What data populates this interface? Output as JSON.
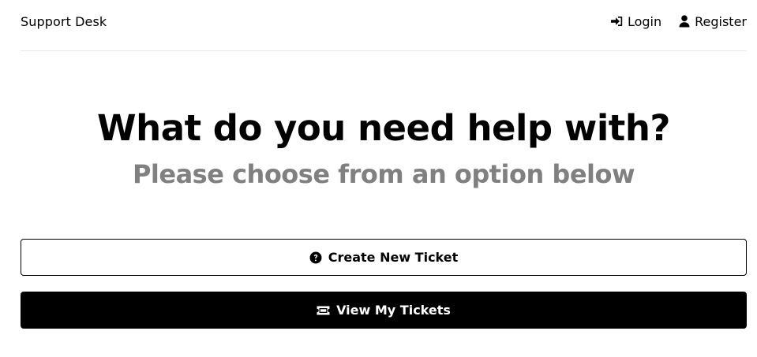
{
  "header": {
    "logo": "Support Desk",
    "nav": [
      {
        "label": "Login",
        "icon": "sign-in-icon"
      },
      {
        "label": "Register",
        "icon": "user-icon"
      }
    ]
  },
  "main": {
    "title": "What do you need help with?",
    "subtitle": "Please choose from an option below",
    "buttons": [
      {
        "label": "Create New Ticket",
        "icon": "question-circle-icon",
        "style": "outline"
      },
      {
        "label": "View My Tickets",
        "icon": "ticket-icon",
        "style": "solid"
      }
    ]
  },
  "colors": {
    "primary": "#000000",
    "subtitle": "#808080",
    "divider": "#e6e6e6",
    "background": "#ffffff"
  }
}
